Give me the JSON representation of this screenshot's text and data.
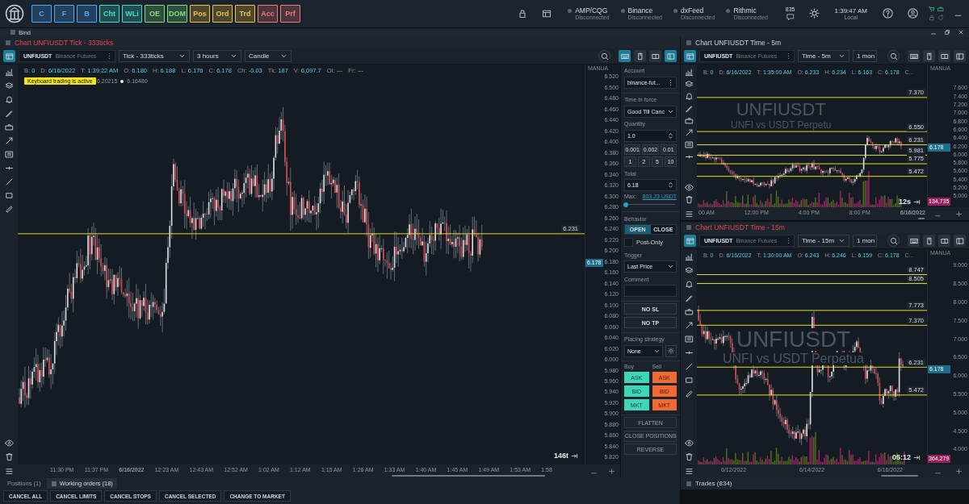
{
  "topbar": {
    "tiles": [
      {
        "label": "C",
        "color": "#4aa8ff"
      },
      {
        "label": "F",
        "color": "#4aa8ff"
      },
      {
        "label": "B",
        "color": "#4aa8ff"
      },
      {
        "label": "Cht",
        "color": "#3fe0c8"
      },
      {
        "label": "WLi",
        "color": "#3fe0c8"
      },
      {
        "label": "OE",
        "color": "#7ee07a"
      },
      {
        "label": "DOM",
        "color": "#7ee07a"
      },
      {
        "label": "Pos",
        "color": "#f0c040"
      },
      {
        "label": "Ord",
        "color": "#f0c040"
      },
      {
        "label": "Trd",
        "color": "#f0c040"
      },
      {
        "label": "Acc",
        "color": "#f07878"
      },
      {
        "label": "Prf",
        "color": "#f07878"
      }
    ],
    "connections": [
      {
        "name": "AMP/CQG",
        "status": "Disconnected"
      },
      {
        "name": "Binance",
        "status": "Disconnected"
      },
      {
        "name": "dxFeed",
        "status": "Disconnected"
      },
      {
        "name": "Rithmic",
        "status": "Disconnected"
      }
    ],
    "badge": "835",
    "clock": {
      "time": "1:39:47 AM",
      "zone": "Local"
    }
  },
  "workspace": {
    "title": "Bind"
  },
  "main_chart": {
    "title": "Chart UNFIUSDT Tick - 333ticks",
    "highlighted": true,
    "symbol": "UNFIUSDT",
    "exchange": "Binance Futures",
    "selectors": [
      {
        "label": "Tick - 333ticks",
        "kind": "dropdown"
      },
      {
        "label": "3 hours",
        "kind": "dropdown"
      },
      {
        "label": "Candle",
        "kind": "dropdown"
      }
    ],
    "toggles": [
      {
        "kind": "layout",
        "on": true
      },
      {
        "kind": "zoom",
        "on": false
      },
      {
        "kind": "keyboard",
        "on": true
      },
      {
        "kind": "mouse",
        "on": false
      },
      {
        "kind": "panels",
        "on": false
      },
      {
        "kind": "sidebar",
        "on": true
      }
    ],
    "info": [
      {
        "label": "B:",
        "value": "0"
      },
      {
        "label": "D:",
        "value": "6/16/2022"
      },
      {
        "label": "T:",
        "value": "1:39:22 AM"
      },
      {
        "label": "O:",
        "value": "6.180"
      },
      {
        "label": "H:",
        "value": "6.188"
      },
      {
        "label": "L:",
        "value": "6.176"
      },
      {
        "label": "C:",
        "value": "6.178"
      },
      {
        "label": "Ch:",
        "value": "-0.03"
      },
      {
        "label": "Tk:",
        "value": "187"
      },
      {
        "label": "V:",
        "value": "6,097.7"
      },
      {
        "label": "OI:",
        "value": "---"
      },
      {
        "label": "Fr:",
        "value": "---"
      }
    ],
    "tooltip": "Keyboard trading is active",
    "indicators": [
      "6.20215",
      "6.16480"
    ],
    "axis_title": "MANUA",
    "ticks": [
      "6.520",
      "6.500",
      "6.480",
      "6.460",
      "6.440",
      "6.420",
      "6.400",
      "6.380",
      "6.360",
      "6.340",
      "6.320",
      "6.300",
      "6.280",
      "6.260",
      "6.240",
      "6.220",
      "6.200",
      "6.180",
      "6.160",
      "6.140",
      "6.120",
      "6.100",
      "6.080",
      "6.060",
      "6.040",
      "6.020",
      "6.000",
      "5.980",
      "5.960",
      "5.940",
      "5.920",
      "5.900",
      "5.880",
      "5.860",
      "5.840",
      "5.820"
    ],
    "levels": [
      "6.231"
    ],
    "price_tag": "6.178",
    "timer": "146t",
    "times": [
      {
        "label": "11:30 PM",
        "kind": "time"
      },
      {
        "label": "11:37 PM",
        "kind": "time"
      },
      {
        "label": "6/16/2022",
        "kind": "date"
      },
      {
        "label": "12:23 AM",
        "kind": "time"
      },
      {
        "label": "12:43 AM",
        "kind": "time"
      },
      {
        "label": "12:52 AM",
        "kind": "time"
      },
      {
        "label": "1:02 AM",
        "kind": "time"
      },
      {
        "label": "1:12 AM",
        "kind": "time"
      },
      {
        "label": "1:15 AM",
        "kind": "time"
      },
      {
        "label": "1:26 AM",
        "kind": "time"
      },
      {
        "label": "1:33 AM",
        "kind": "time"
      },
      {
        "label": "1:40 AM",
        "kind": "time"
      },
      {
        "label": "1:45 AM",
        "kind": "time"
      },
      {
        "label": "1:49 AM",
        "kind": "time"
      },
      {
        "label": "1:53 AM",
        "kind": "time"
      },
      {
        "label": "1:58",
        "kind": "time"
      }
    ]
  },
  "order_panel": {
    "account": {
      "label": "Account",
      "value": "binance-fut..."
    },
    "time_in_force": {
      "label": "Time in force",
      "value": "Good Till Canc"
    },
    "quantity": {
      "label": "Quantity",
      "value": "1.0",
      "presets": [
        "0.001",
        "0.002",
        "0.01",
        "1",
        "2",
        "5",
        "10"
      ]
    },
    "total": {
      "label": "Total",
      "value": "6.18"
    },
    "max": {
      "label": "Max:",
      "value": "803.23 USDT"
    },
    "slider": {
      "level": 0.0
    },
    "behavior": {
      "label": "Behavior",
      "options": [
        {
          "label": "OPEN",
          "selected": true
        },
        {
          "label": "CLOSE",
          "selected": false
        }
      ]
    },
    "post_only": {
      "label": "Post-Only",
      "checked": false
    },
    "trigger": {
      "label": "Trigger",
      "value": "Last Price"
    },
    "comment": {
      "label": "Comment"
    },
    "protection": [
      "NO SL",
      "NO TP"
    ],
    "placing_strategy": {
      "label": "Placing strategy",
      "value": "None"
    },
    "buy": {
      "label": "Buy",
      "buttons": [
        "ASK",
        "BID",
        "MKT"
      ]
    },
    "sell": {
      "label": "Sell",
      "buttons": [
        "ASK",
        "BID",
        "MKT"
      ]
    },
    "actions": [
      "FLATTEN",
      "CLOSE POSITIONS",
      "REVERSE"
    ]
  },
  "side_charts": [
    {
      "title": "Chart UNFIUSDT Time - 5m",
      "highlighted": false,
      "symbol": "UNFIUSDT",
      "exchange": "Binance Futures",
      "selectors": [
        {
          "label": "Time - 5m",
          "kind": "dropdown"
        },
        {
          "label": "1 mon",
          "kind": "field"
        }
      ],
      "toggles": [
        {
          "kind": "layout",
          "on": true
        },
        {
          "kind": "zoom",
          "on": false
        },
        {
          "kind": "keyboard",
          "on": false
        },
        {
          "kind": "mouse",
          "on": false
        },
        {
          "kind": "panels",
          "on": false
        },
        {
          "kind": "sidebar",
          "on": false
        }
      ],
      "info": [
        {
          "label": "B:",
          "value": "0"
        },
        {
          "label": "D:",
          "value": "6/16/2022"
        },
        {
          "label": "T:",
          "value": "1:35:00 AM"
        },
        {
          "label": "O:",
          "value": "6.233"
        },
        {
          "label": "H:",
          "value": "6.234"
        },
        {
          "label": "L:",
          "value": "6.163"
        },
        {
          "label": "C:",
          "value": "6.178"
        },
        {
          "label": "C..."
        }
      ],
      "watermark": {
        "symbol": "UNFIUSDT",
        "description": "UNFI vs USDT Perpetu"
      },
      "axis_title": "MANUA",
      "ticks": [
        "7.600",
        "7.400",
        "7.200",
        "7.000",
        "6.800",
        "6.600",
        "6.400",
        "6.200",
        "6.000",
        "5.800",
        "5.600",
        "5.400",
        "5.200",
        "5.000"
      ],
      "levels": [
        "7.370",
        "6.550",
        "6.231",
        "5.981",
        "5.775",
        "5.472"
      ],
      "price_tag": "6.178",
      "volume_tag": "134,735",
      "timer": "12s",
      "times": [
        {
          "label": "00 AM",
          "kind": "time"
        },
        {
          "label": "12:00 PM",
          "kind": "time"
        },
        {
          "label": "4:00 PM",
          "kind": "time"
        },
        {
          "label": "8:00 PM",
          "kind": "time"
        },
        {
          "label": "6/16/2022",
          "kind": "date"
        }
      ]
    },
    {
      "title": "Chart UNFIUSDT Time - 15m",
      "highlighted": true,
      "symbol": "UNFIUSDT",
      "exchange": "Binance Futures",
      "selectors": [
        {
          "label": "Time - 15m",
          "kind": "dropdown"
        },
        {
          "label": "1 mon",
          "kind": "field"
        }
      ],
      "toggles": [
        {
          "kind": "layout",
          "on": true
        },
        {
          "kind": "zoom",
          "on": false
        },
        {
          "kind": "keyboard",
          "on": false
        },
        {
          "kind": "mouse",
          "on": false
        },
        {
          "kind": "panels",
          "on": false
        },
        {
          "kind": "sidebar",
          "on": false
        }
      ],
      "info": [
        {
          "label": "B:",
          "value": "0"
        },
        {
          "label": "D:",
          "value": "6/16/2022"
        },
        {
          "label": "T:",
          "value": "1:30:00 AM"
        },
        {
          "label": "O:",
          "value": "6.243"
        },
        {
          "label": "H:",
          "value": "6.246"
        },
        {
          "label": "L:",
          "value": "6.159"
        },
        {
          "label": "C:",
          "value": "6.178"
        },
        {
          "label": "C..."
        }
      ],
      "watermark": {
        "symbol": "UNFIUSDT",
        "description": "UNFI vs USDT Perpetua"
      },
      "axis_title": "MANUA",
      "ticks": [
        "9.000",
        "8.500",
        "8.000",
        "7.500",
        "7.000",
        "6.500",
        "6.000",
        "5.500",
        "5.000",
        "4.500",
        "4.000"
      ],
      "levels": [
        "8.747",
        "8.505",
        "7.773",
        "7.370",
        "6.231",
        "5.472"
      ],
      "price_tag": "6.178",
      "volume_tag": "364,279",
      "timer": "05:12",
      "times": [
        {
          "label": "6/12/2022",
          "kind": "time"
        },
        {
          "label": "6/14/2022",
          "kind": "time"
        },
        {
          "label": "6/16/2022",
          "kind": "time"
        }
      ]
    }
  ],
  "bottom_panel": {
    "tabs": [
      {
        "label": "Positions (1)",
        "selected": false
      },
      {
        "label": "Working orders (18)",
        "selected": true
      }
    ],
    "buttons": [
      "CANCEL ALL",
      "CANCEL LIMITS",
      "CANCEL STOPS",
      "CANCEL SELECTED",
      "CHANGE TO MARKET"
    ]
  },
  "trades_panel": {
    "title": "Trades (834)"
  }
}
